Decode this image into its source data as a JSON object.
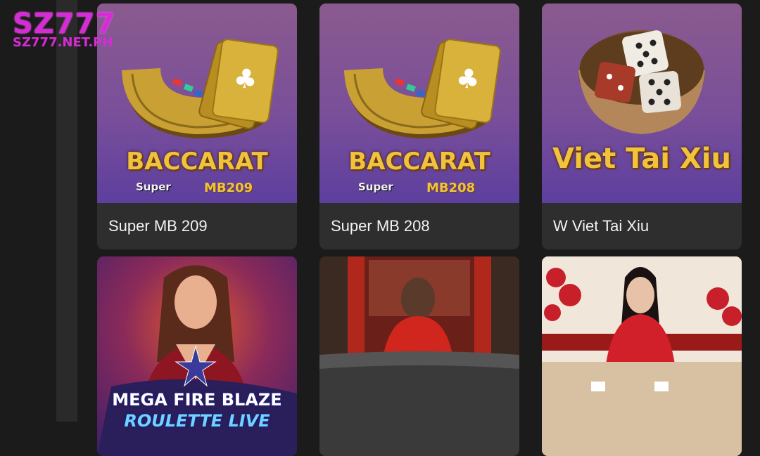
{
  "brand": {
    "name": "SZ777",
    "domain": "SZ777.NET.PH",
    "color": "#d62bd6"
  },
  "games": [
    {
      "title": "Super MB 209",
      "art_title": "BACCARAT",
      "art_sub": "Super",
      "art_code": "MB209"
    },
    {
      "title": "Super MB 208",
      "art_title": "BACCARAT",
      "art_sub": "Super",
      "art_code": "MB208"
    },
    {
      "title": "W Viet Tai Xiu",
      "art_title": "Viet Tai Xiu"
    },
    {
      "art_title": "MEGA FIRE BLAZE",
      "art_sub": "ROULETTE LIVE"
    },
    {},
    {}
  ],
  "colors": {
    "background": "#1b1b1b",
    "card": "#2e2e2e",
    "gold": "#f2c23c"
  }
}
